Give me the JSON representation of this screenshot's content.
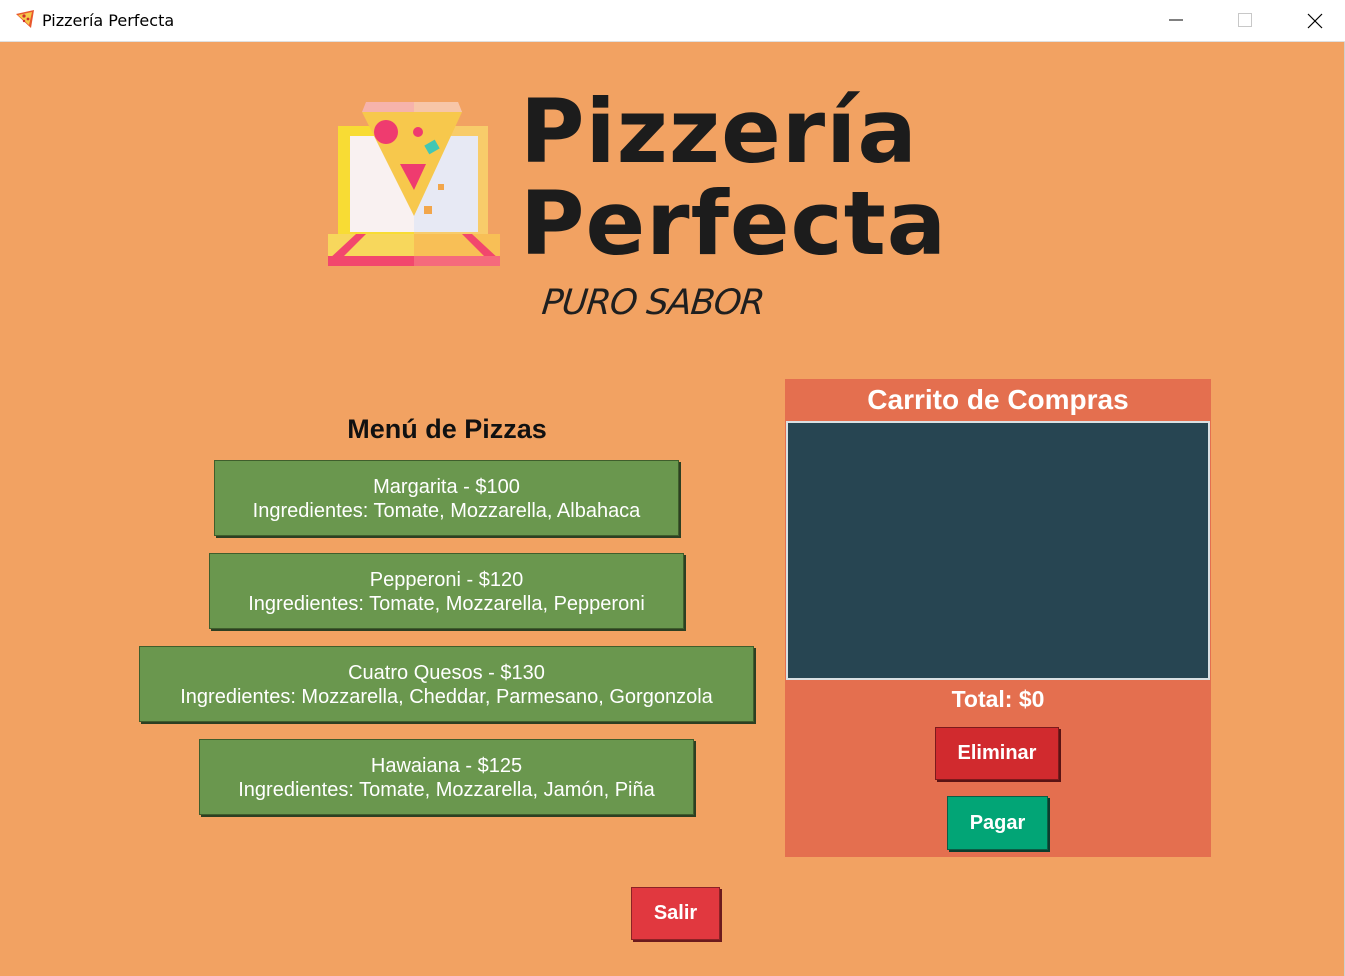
{
  "window": {
    "title": "Pizzería Perfecta",
    "minimize": "minimize-icon",
    "maximize": "maximize-icon",
    "close": "close-icon"
  },
  "logo": {
    "line1": "Pizzería",
    "line2": "Perfecta",
    "tagline": "PURO SABOR",
    "icon": "pizza-box-icon"
  },
  "menu": {
    "heading": "Menú de Pizzas",
    "pizzas": [
      {
        "name_price": "Margarita - $100",
        "ingredients": "Ingredientes: Tomate, Mozzarella, Albahaca"
      },
      {
        "name_price": "Pepperoni - $120",
        "ingredients": "Ingredientes: Tomate, Mozzarella, Pepperoni"
      },
      {
        "name_price": "Cuatro Quesos - $130",
        "ingredients": "Ingredientes: Mozzarella, Cheddar, Parmesano, Gorgonzola"
      },
      {
        "name_price": "Hawaiana - $125",
        "ingredients": "Ingredientes: Tomate, Mozzarella, Jamón, Piña"
      }
    ]
  },
  "cart": {
    "title": "Carrito de Compras",
    "items": [],
    "total": "Total: $0",
    "delete_label": "Eliminar",
    "pay_label": "Pagar"
  },
  "exit_label": "Salir",
  "colors": {
    "background": "#f2a262",
    "pizza_button": "#6a974e",
    "cart_panel": "#e46f4f",
    "cart_list": "#274552",
    "eliminar": "#d12a2e",
    "pagar": "#02a576",
    "salir": "#e1383f"
  }
}
